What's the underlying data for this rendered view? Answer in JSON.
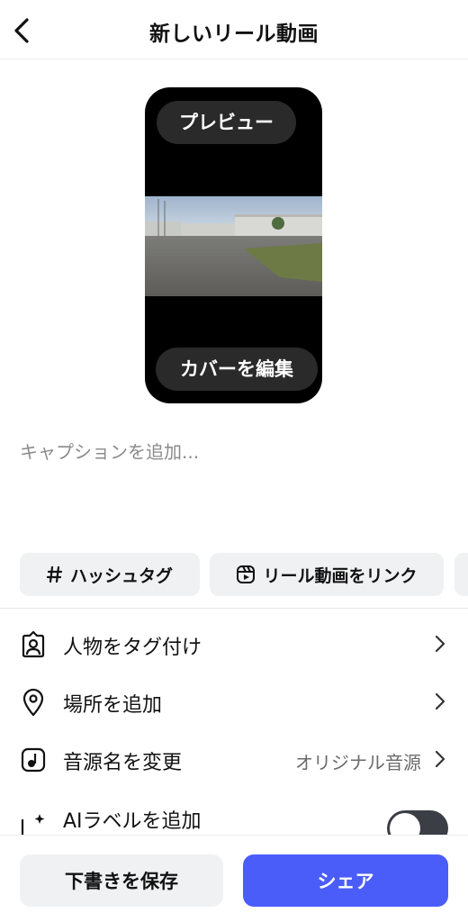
{
  "header": {
    "title": "新しいリール動画"
  },
  "preview": {
    "preview_label": "プレビュー",
    "edit_cover_label": "カバーを編集"
  },
  "caption": {
    "placeholder": "キャプションを追加..."
  },
  "chips": {
    "hashtag": "ハッシュタグ",
    "link_reel": "リール動画をリンク"
  },
  "options": [
    {
      "label": "人物をタグ付け"
    },
    {
      "label": "場所を追加"
    },
    {
      "label": "音源名を変更",
      "value": "オリジナル音源"
    },
    {
      "label": "AIラベルを追加",
      "toggle": false
    }
  ],
  "actions": {
    "draft": "下書きを保存",
    "share": "シェア"
  },
  "colors": {
    "share_button": "#4a5df9",
    "chip_bg": "#eff1f3",
    "toggle_off": "#3b3f45"
  }
}
